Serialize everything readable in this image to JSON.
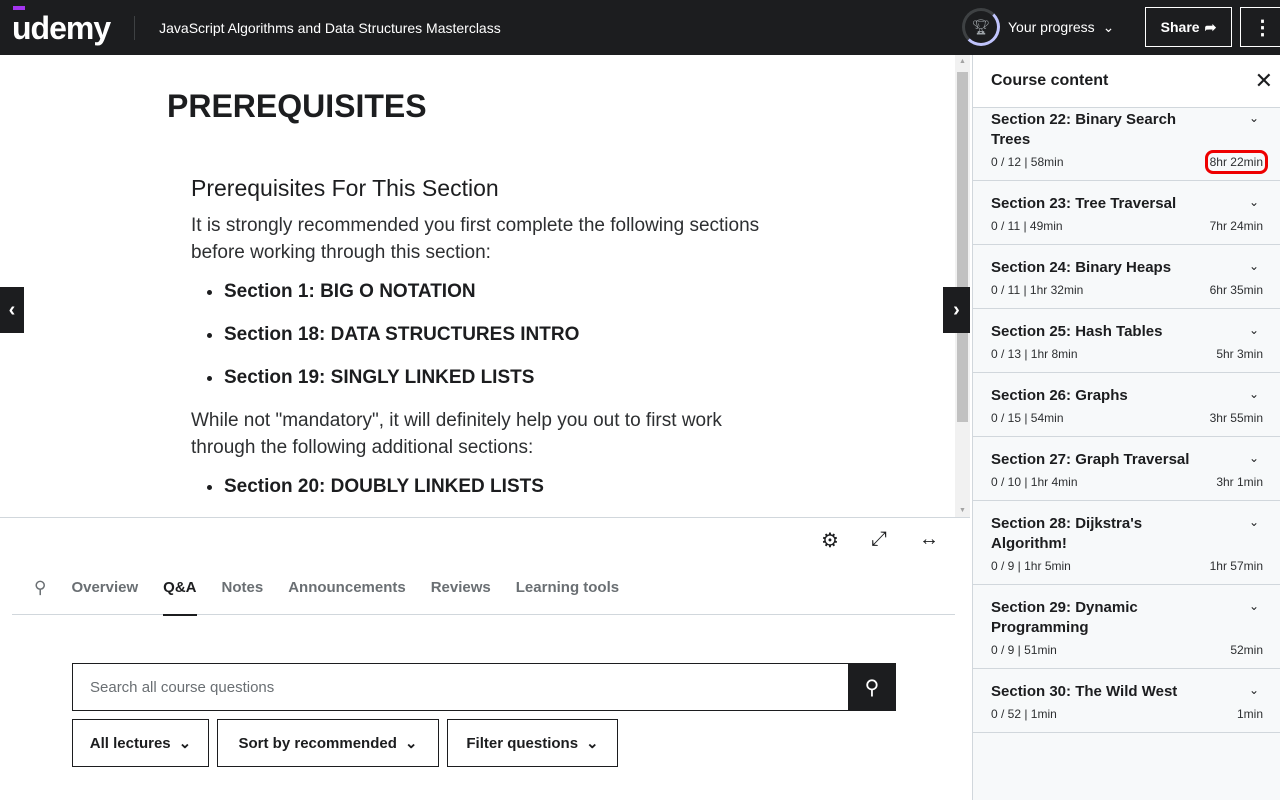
{
  "header": {
    "logo": "udemy",
    "course_title": "JavaScript Algorithms and Data Structures Masterclass",
    "progress_label": "Your progress",
    "share_label": "Share"
  },
  "lecture": {
    "title": "PREREQUISITES",
    "subheading": "Prerequisites For This Section",
    "intro": "It is strongly recommended you first complete the following sections before working through this section:",
    "required": [
      "Section 1: BIG O NOTATION",
      "Section 18: DATA STRUCTURES INTRO",
      "Section 19: SINGLY LINKED LISTS"
    ],
    "optional_intro": "While not \"mandatory\", it will definitely help you out to first work through the following additional sections:",
    "optional": [
      "Section 20: DOUBLY LINKED LISTS"
    ]
  },
  "tabs": [
    {
      "label": "Overview"
    },
    {
      "label": "Q&A",
      "active": true
    },
    {
      "label": "Notes"
    },
    {
      "label": "Announcements"
    },
    {
      "label": "Reviews"
    },
    {
      "label": "Learning tools"
    }
  ],
  "qa": {
    "search_placeholder": "Search all course questions",
    "filters": [
      "All lectures",
      "Sort by recommended",
      "Filter questions"
    ]
  },
  "sidebar": {
    "title": "Course content",
    "sections": [
      {
        "title": "Section 22: Binary Search Trees",
        "progress": "0 / 12 | 58min",
        "duration": "8hr 22min",
        "highlighted": true
      },
      {
        "title": "Section 23: Tree Traversal",
        "progress": "0 / 11 | 49min",
        "duration": "7hr 24min"
      },
      {
        "title": "Section 24: Binary Heaps",
        "progress": "0 / 11 | 1hr 32min",
        "duration": "6hr 35min"
      },
      {
        "title": "Section 25: Hash Tables",
        "progress": "0 / 13 | 1hr 8min",
        "duration": "5hr 3min"
      },
      {
        "title": "Section 26: Graphs",
        "progress": "0 / 15 | 54min",
        "duration": "3hr 55min"
      },
      {
        "title": "Section 27: Graph Traversal",
        "progress": "0 / 10 | 1hr 4min",
        "duration": "3hr 1min"
      },
      {
        "title": "Section 28: Dijkstra's Algorithm!",
        "progress": "0 / 9 | 1hr 5min",
        "duration": "1hr 57min"
      },
      {
        "title": "Section 29: Dynamic Programming",
        "progress": "0 / 9 | 51min",
        "duration": "52min"
      },
      {
        "title": "Section 30: The Wild West",
        "progress": "0 / 52 | 1min",
        "duration": "1min"
      }
    ]
  },
  "colors": {
    "header_bg": "#1c1d1f",
    "brand": "#a435f0",
    "highlight": "#e00000"
  }
}
